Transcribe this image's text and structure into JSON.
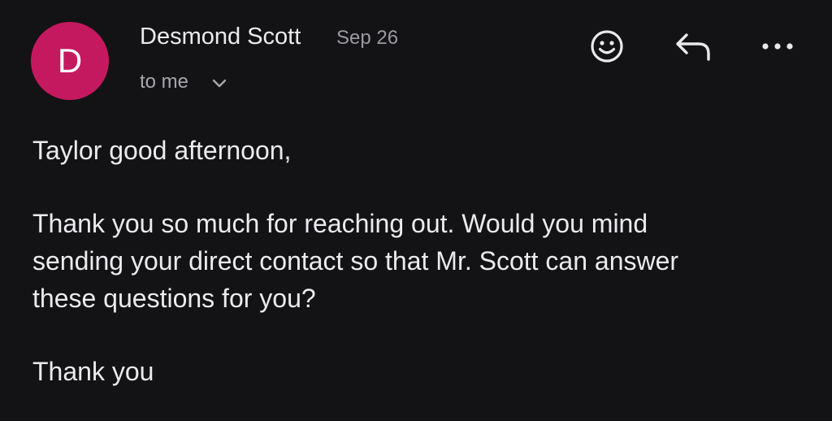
{
  "sender": {
    "avatar_letter": "D",
    "avatar_color": "#c5195f",
    "name": "Desmond Scott",
    "date": "Sep 26"
  },
  "recipient": {
    "label": "to me",
    "expand_icon": "chevron-down-icon"
  },
  "actions": [
    {
      "name": "emoji-react",
      "icon": "smiley-icon"
    },
    {
      "name": "reply",
      "icon": "reply-arrow-icon"
    },
    {
      "name": "more-options",
      "icon": "more-horizontal-icon"
    }
  ],
  "message": {
    "greeting": "Taylor good afternoon,",
    "body_lines": [
      "Thank you so much for reaching out. Would you mind",
      "sending your direct contact so that Mr. Scott can answer",
      "these questions for you?"
    ],
    "closing": "Thank you"
  },
  "theme": {
    "background": "#131214",
    "text": "#ebeaee",
    "muted_text": "#9c9aa2"
  }
}
